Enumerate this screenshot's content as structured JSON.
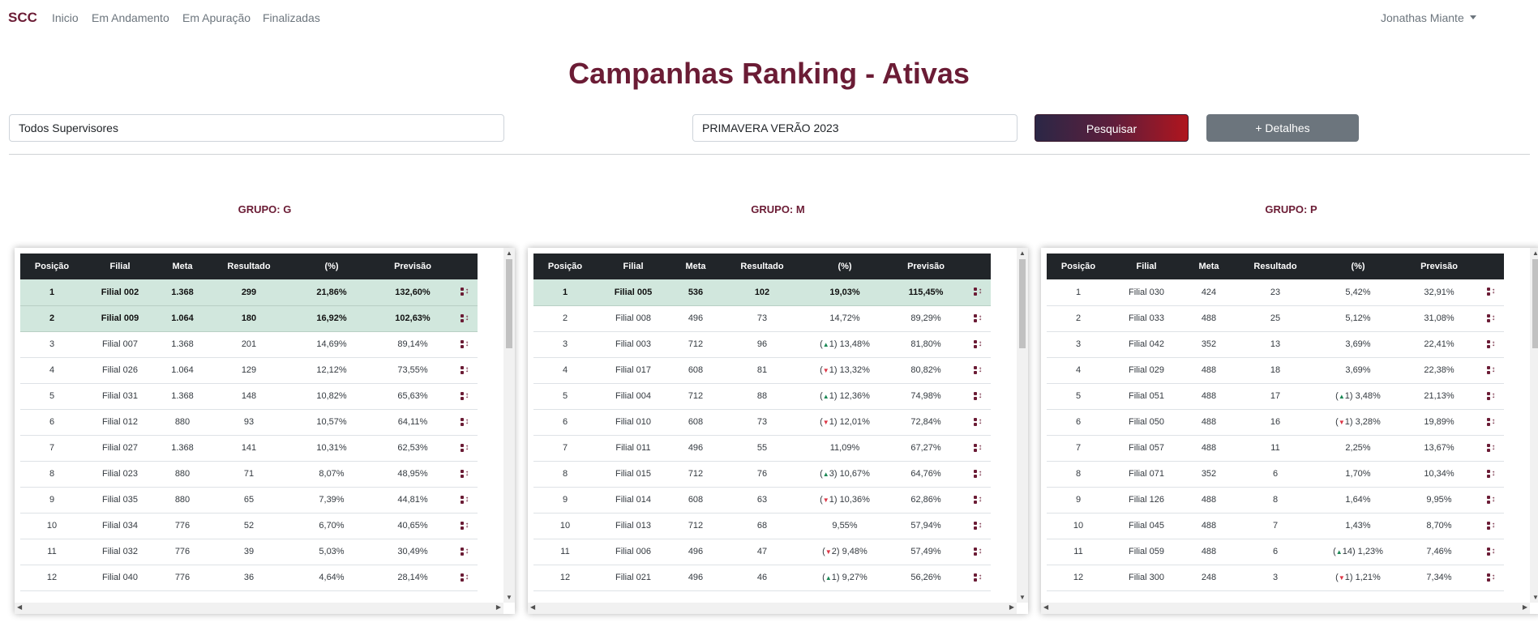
{
  "nav": {
    "brand": "SCC",
    "links": [
      "Inicio",
      "Em Andamento",
      "Em Apuração",
      "Finalizadas"
    ],
    "user": "Jonathas Miante"
  },
  "title": "Campanhas Ranking - Ativas",
  "filters": {
    "supervisor": "Todos Supervisores",
    "campaign": "PRIMAVERA VERÃO 2023",
    "search_label": "Pesquisar",
    "details_label": "+ Detalhes"
  },
  "columns": [
    "Posição",
    "Filial",
    "Meta",
    "Resultado",
    "(%)",
    "Previsão"
  ],
  "groups": [
    {
      "title": "GRUPO: G",
      "rows": [
        {
          "pos": "1",
          "filial": "Filial 002",
          "meta": "1.368",
          "resultado": "299",
          "pct": "21,86%",
          "previsao": "132,60%",
          "hl": true
        },
        {
          "pos": "2",
          "filial": "Filial 009",
          "meta": "1.064",
          "resultado": "180",
          "pct": "16,92%",
          "previsao": "102,63%",
          "hl": true
        },
        {
          "pos": "3",
          "filial": "Filial 007",
          "meta": "1.368",
          "resultado": "201",
          "pct": "14,69%",
          "previsao": "89,14%"
        },
        {
          "pos": "4",
          "filial": "Filial 026",
          "meta": "1.064",
          "resultado": "129",
          "pct": "12,12%",
          "previsao": "73,55%"
        },
        {
          "pos": "5",
          "filial": "Filial 031",
          "meta": "1.368",
          "resultado": "148",
          "pct": "10,82%",
          "previsao": "65,63%"
        },
        {
          "pos": "6",
          "filial": "Filial 012",
          "meta": "880",
          "resultado": "93",
          "pct": "10,57%",
          "previsao": "64,11%"
        },
        {
          "pos": "7",
          "filial": "Filial 027",
          "meta": "1.368",
          "resultado": "141",
          "pct": "10,31%",
          "previsao": "62,53%"
        },
        {
          "pos": "8",
          "filial": "Filial 023",
          "meta": "880",
          "resultado": "71",
          "pct": "8,07%",
          "previsao": "48,95%"
        },
        {
          "pos": "9",
          "filial": "Filial 035",
          "meta": "880",
          "resultado": "65",
          "pct": "7,39%",
          "previsao": "44,81%"
        },
        {
          "pos": "10",
          "filial": "Filial 034",
          "meta": "776",
          "resultado": "52",
          "pct": "6,70%",
          "previsao": "40,65%"
        },
        {
          "pos": "11",
          "filial": "Filial 032",
          "meta": "776",
          "resultado": "39",
          "pct": "5,03%",
          "previsao": "30,49%"
        },
        {
          "pos": "12",
          "filial": "Filial 040",
          "meta": "776",
          "resultado": "36",
          "pct": "4,64%",
          "previsao": "28,14%"
        }
      ]
    },
    {
      "title": "GRUPO: M",
      "rows": [
        {
          "pos": "1",
          "filial": "Filial 005",
          "meta": "536",
          "resultado": "102",
          "pct": "19,03%",
          "previsao": "115,45%",
          "hl": true
        },
        {
          "pos": "2",
          "filial": "Filial 008",
          "meta": "496",
          "resultado": "73",
          "pct": "14,72%",
          "previsao": "89,29%"
        },
        {
          "pos": "3",
          "filial": "Filial 003",
          "meta": "712",
          "resultado": "96",
          "pct": "13,48%",
          "previsao": "81,80%",
          "change": {
            "dir": "up",
            "n": "1"
          }
        },
        {
          "pos": "4",
          "filial": "Filial 017",
          "meta": "608",
          "resultado": "81",
          "pct": "13,32%",
          "previsao": "80,82%",
          "change": {
            "dir": "down",
            "n": "1"
          }
        },
        {
          "pos": "5",
          "filial": "Filial 004",
          "meta": "712",
          "resultado": "88",
          "pct": "12,36%",
          "previsao": "74,98%",
          "change": {
            "dir": "up",
            "n": "1"
          }
        },
        {
          "pos": "6",
          "filial": "Filial 010",
          "meta": "608",
          "resultado": "73",
          "pct": "12,01%",
          "previsao": "72,84%",
          "change": {
            "dir": "down",
            "n": "1"
          }
        },
        {
          "pos": "7",
          "filial": "Filial 011",
          "meta": "496",
          "resultado": "55",
          "pct": "11,09%",
          "previsao": "67,27%"
        },
        {
          "pos": "8",
          "filial": "Filial 015",
          "meta": "712",
          "resultado": "76",
          "pct": "10,67%",
          "previsao": "64,76%",
          "change": {
            "dir": "up",
            "n": "3"
          }
        },
        {
          "pos": "9",
          "filial": "Filial 014",
          "meta": "608",
          "resultado": "63",
          "pct": "10,36%",
          "previsao": "62,86%",
          "change": {
            "dir": "down",
            "n": "1"
          }
        },
        {
          "pos": "10",
          "filial": "Filial 013",
          "meta": "712",
          "resultado": "68",
          "pct": "9,55%",
          "previsao": "57,94%"
        },
        {
          "pos": "11",
          "filial": "Filial 006",
          "meta": "496",
          "resultado": "47",
          "pct": "9,48%",
          "previsao": "57,49%",
          "change": {
            "dir": "down",
            "n": "2"
          }
        },
        {
          "pos": "12",
          "filial": "Filial 021",
          "meta": "496",
          "resultado": "46",
          "pct": "9,27%",
          "previsao": "56,26%",
          "change": {
            "dir": "up",
            "n": "1"
          }
        }
      ]
    },
    {
      "title": "GRUPO: P",
      "rows": [
        {
          "pos": "1",
          "filial": "Filial 030",
          "meta": "424",
          "resultado": "23",
          "pct": "5,42%",
          "previsao": "32,91%"
        },
        {
          "pos": "2",
          "filial": "Filial 033",
          "meta": "488",
          "resultado": "25",
          "pct": "5,12%",
          "previsao": "31,08%"
        },
        {
          "pos": "3",
          "filial": "Filial 042",
          "meta": "352",
          "resultado": "13",
          "pct": "3,69%",
          "previsao": "22,41%"
        },
        {
          "pos": "4",
          "filial": "Filial 029",
          "meta": "488",
          "resultado": "18",
          "pct": "3,69%",
          "previsao": "22,38%"
        },
        {
          "pos": "5",
          "filial": "Filial 051",
          "meta": "488",
          "resultado": "17",
          "pct": "3,48%",
          "previsao": "21,13%",
          "change": {
            "dir": "up",
            "n": "1"
          }
        },
        {
          "pos": "6",
          "filial": "Filial 050",
          "meta": "488",
          "resultado": "16",
          "pct": "3,28%",
          "previsao": "19,89%",
          "change": {
            "dir": "down",
            "n": "1"
          }
        },
        {
          "pos": "7",
          "filial": "Filial 057",
          "meta": "488",
          "resultado": "11",
          "pct": "2,25%",
          "previsao": "13,67%"
        },
        {
          "pos": "8",
          "filial": "Filial 071",
          "meta": "352",
          "resultado": "6",
          "pct": "1,70%",
          "previsao": "10,34%"
        },
        {
          "pos": "9",
          "filial": "Filial 126",
          "meta": "488",
          "resultado": "8",
          "pct": "1,64%",
          "previsao": "9,95%"
        },
        {
          "pos": "10",
          "filial": "Filial 045",
          "meta": "488",
          "resultado": "7",
          "pct": "1,43%",
          "previsao": "8,70%"
        },
        {
          "pos": "11",
          "filial": "Filial 059",
          "meta": "488",
          "resultado": "6",
          "pct": "1,23%",
          "previsao": "7,46%",
          "change": {
            "dir": "up",
            "n": "14"
          }
        },
        {
          "pos": "12",
          "filial": "Filial 300",
          "meta": "248",
          "resultado": "3",
          "pct": "1,21%",
          "previsao": "7,34%",
          "change": {
            "dir": "down",
            "n": "1"
          }
        }
      ]
    }
  ]
}
